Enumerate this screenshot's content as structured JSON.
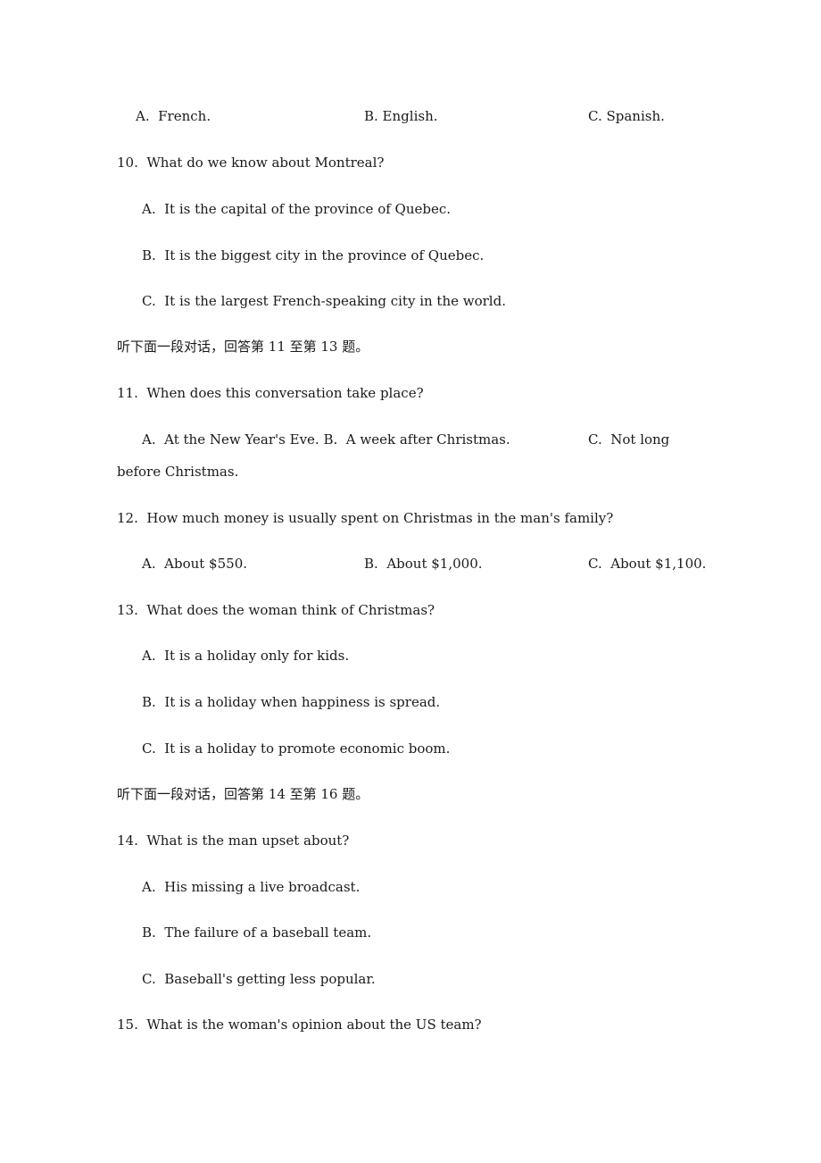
{
  "q9_options": {
    "A": "A.  French.",
    "B": "B. English.",
    "C": "C. Spanish."
  },
  "q10": {
    "question": "10.  What do we know about Montreal?",
    "options": [
      "A.  It is the capital of the province of Quebec.",
      "B.  It is the biggest city in the province of Quebec.",
      "C.  It is the largest French-speaking city in the world."
    ]
  },
  "section_11_13": "听下面一段对话，回答第 11 至第 13 题。",
  "q11": {
    "question": "11.  When does this conversation take place?",
    "options_line": "A.  At the New Year's Eve. B.  A week after Christmas.",
    "option_c_start": "C.  Not long",
    "option_c_cont": "before Christmas."
  },
  "q12": {
    "question": "12.  How much money is usually spent on Christmas in the man's family?",
    "options": {
      "A": "A.  About $550.",
      "B": "B.  About $1,000.",
      "C": "C.  About $1,100."
    }
  },
  "q13": {
    "question": "13.  What does the woman think of Christmas?",
    "options": [
      "A.  It is a holiday only for kids.",
      "B.  It is a holiday when happiness is spread.",
      "C.  It is a holiday to promote economic boom."
    ]
  },
  "section_14_16": "听下面一段对话，回答第 14 至第 16 题。",
  "q14": {
    "question": "14.  What is the man upset about?",
    "options": [
      "A.  His missing a live broadcast.",
      "B.  The failure of a baseball team.",
      "C.  Baseball's getting less popular."
    ]
  },
  "q15": {
    "question": "15.  What is the woman's opinion about the US team?"
  }
}
